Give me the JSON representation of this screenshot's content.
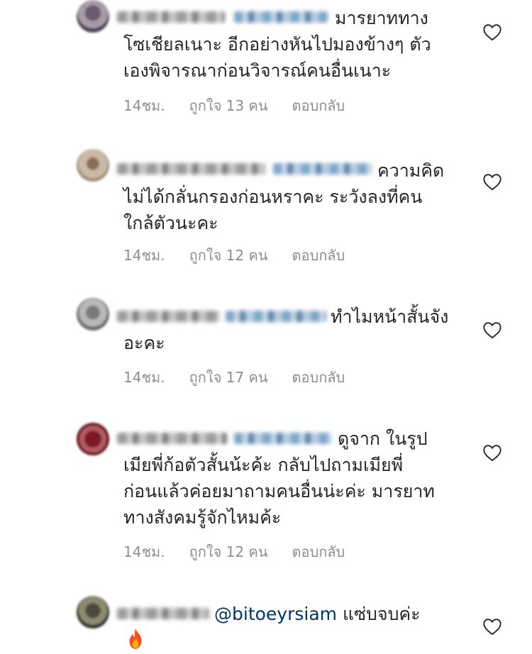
{
  "comments": [
    {
      "lines": [
        "มารยาททาง",
        "โซเชียลเนาะ อีกอย่างหันไปมองข้างๆ ตัว",
        "เองพิจารณาก่อนวิจารณ์คนอื่นเนาะ"
      ],
      "time": "14ชม.",
      "likes": "ถูกใจ 13 คน",
      "reply": "ตอบกลับ"
    },
    {
      "lines": [
        "ความคิด",
        "ไม่ได้กลั่นกรองก่อนหราคะ ระวังลงที่คน",
        "ใกล้ตัวนะคะ"
      ],
      "time": "14ชม.",
      "likes": "ถูกใจ 12 คน",
      "reply": "ตอบกลับ"
    },
    {
      "lines": [
        "ทำไมหน้าสั้นจัง",
        "อะคะ"
      ],
      "time": "14ชม.",
      "likes": "ถูกใจ 17 คน",
      "reply": "ตอบกลับ"
    },
    {
      "lines": [
        "ดูจาก ในรูป",
        "เมียพี่ก้อตัวสั้นน้ะค้ะ กลับไปถามเมียพี่",
        "ก่อนแล้วค่อยมาถามคนอื่นน่ะค่ะ มารยาท",
        "ทางสังคมรู้จักไหมค้ะ"
      ],
      "time": "14ชม.",
      "likes": "ถูกใจ 12 คน",
      "reply": "ตอบกลับ"
    },
    {
      "mention": "@bitoeyrsiam",
      "lines": [
        "แซ่บจบค่ะ"
      ]
    }
  ],
  "icons": {
    "like": "heart-outline-icon",
    "emoji": "fire-emoji-icon"
  },
  "colors": {
    "text": "#262626",
    "meta": "#8e8e8e",
    "mention": "#003569"
  }
}
